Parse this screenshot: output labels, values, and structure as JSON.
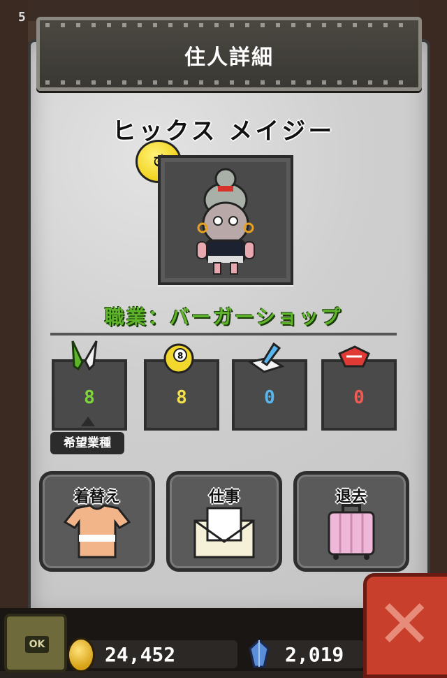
{
  "level": "5",
  "header": {
    "title": "住人詳細"
  },
  "resident": {
    "name": "ヒックス メイジー",
    "mood_icon": "dizzy-face-icon",
    "job": "職業：バーガーショップ"
  },
  "stats": [
    {
      "icon": "fork-knife-icon",
      "value": "8",
      "color": "#7fd63a",
      "preferred": true
    },
    {
      "icon": "eight-ball-icon",
      "value": "8",
      "color": "#f4e04a"
    },
    {
      "icon": "pen-book-icon",
      "value": "0",
      "color": "#57b6ef"
    },
    {
      "icon": "red-box-icon",
      "value": "0",
      "color": "#f05a54"
    }
  ],
  "preferred_label": "希望業種",
  "actions": [
    {
      "label": "着替え",
      "icon": "shirt-icon"
    },
    {
      "label": "仕事",
      "icon": "envelope-icon"
    },
    {
      "label": "退去",
      "icon": "suitcase-icon"
    }
  ],
  "footer": {
    "ok_label": "OK",
    "coins": "24,452",
    "gems": "2,019"
  },
  "close_icon": "close-x-icon"
}
